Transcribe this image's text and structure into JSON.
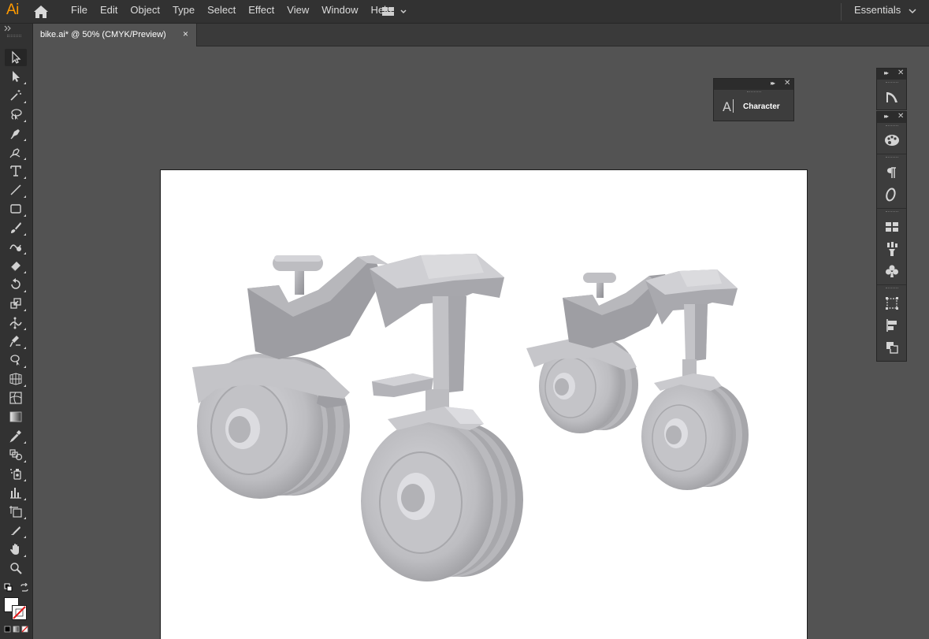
{
  "app": {
    "logo": "Ai"
  },
  "menus": [
    "File",
    "Edit",
    "Object",
    "Type",
    "Select",
    "Effect",
    "View",
    "Window",
    "Help"
  ],
  "workspace": {
    "label": "Essentials"
  },
  "document": {
    "tab_title": "bike.ai* @ 50% (CMYK/Preview)",
    "close_glyph": "×"
  },
  "tools": [
    {
      "name": "selection-tool-icon",
      "active": true
    },
    {
      "name": "direct-selection-tool-icon"
    },
    {
      "name": "magic-wand-tool-icon"
    },
    {
      "name": "lasso-tool-icon"
    },
    {
      "name": "pen-tool-icon"
    },
    {
      "name": "curvature-tool-icon"
    },
    {
      "name": "type-tool-icon"
    },
    {
      "name": "line-segment-tool-icon"
    },
    {
      "name": "rectangle-tool-icon"
    },
    {
      "name": "paintbrush-tool-icon"
    },
    {
      "name": "shaper-tool-icon"
    },
    {
      "name": "eraser-tool-icon"
    },
    {
      "name": "rotate-tool-icon"
    },
    {
      "name": "scale-tool-icon"
    },
    {
      "name": "width-tool-icon"
    },
    {
      "name": "puppet-warp-tool-icon"
    },
    {
      "name": "shape-builder-tool-icon"
    },
    {
      "name": "perspective-grid-tool-icon"
    },
    {
      "name": "mesh-tool-icon"
    },
    {
      "name": "gradient-tool-icon"
    },
    {
      "name": "eyedropper-tool-icon"
    },
    {
      "name": "blend-tool-icon"
    },
    {
      "name": "symbol-sprayer-tool-icon"
    },
    {
      "name": "column-graph-tool-icon"
    },
    {
      "name": "artboard-tool-icon"
    },
    {
      "name": "slice-tool-icon"
    },
    {
      "name": "hand-tool-icon"
    },
    {
      "name": "zoom-tool-icon"
    }
  ],
  "panels": {
    "character": {
      "label": "Character",
      "icon_glyph": "A"
    }
  },
  "dock_icons": [
    "appearance-icon",
    "color-guide-icon",
    "paragraph-icon",
    "opentype-icon",
    "swatches-icon",
    "brushes-icon",
    "symbols-icon",
    "transform-icon",
    "align-icon",
    "pathfinder-icon"
  ],
  "colors": {
    "app_bg": "#535353",
    "bar": "#323232",
    "accent": "#ff9a00",
    "artboard": "#ffffff",
    "bike_metal": "#b9b9bd"
  }
}
